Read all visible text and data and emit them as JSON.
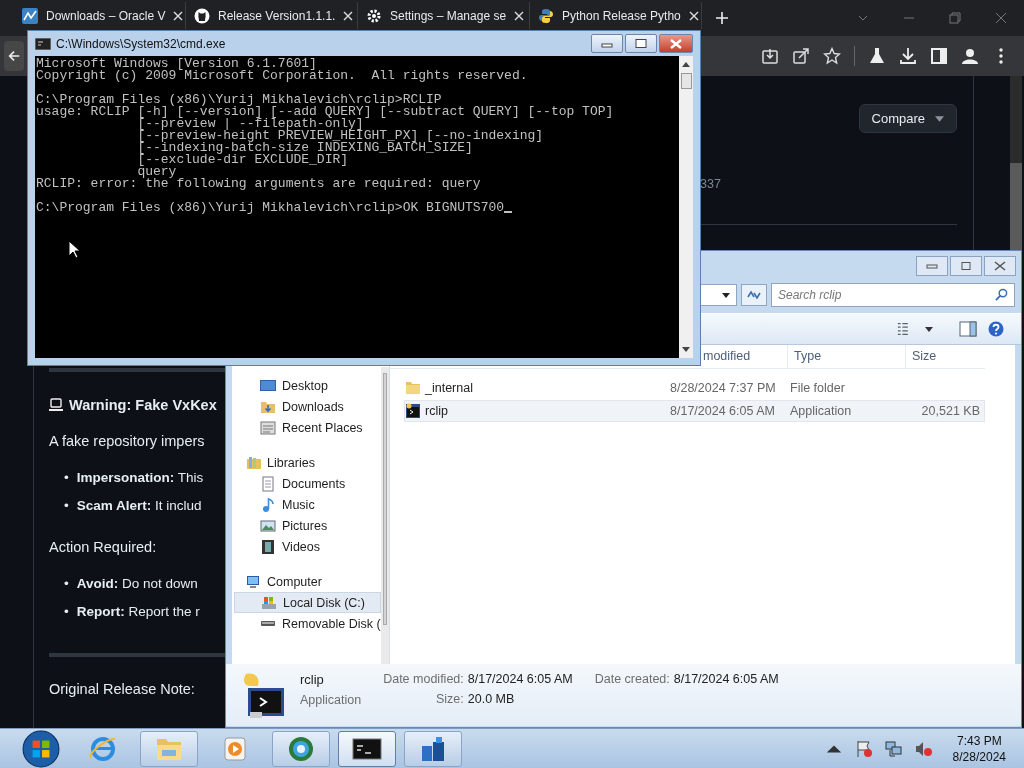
{
  "browser": {
    "tabs": [
      {
        "title": "Downloads – Oracle V",
        "kind": "chart",
        "selected": false
      },
      {
        "title": "Release Version1.1.1.",
        "kind": "cat",
        "selected": false
      },
      {
        "title": "Settings – Manage se",
        "kind": "gear",
        "selected": false
      },
      {
        "title": "Python Release Pytho",
        "kind": "snake",
        "selected": false
      }
    ],
    "compare_button": "Compare",
    "fragment": "337",
    "article": {
      "heading": "Warning: Fake VxKex",
      "intro": "A fake repository impers",
      "bullets": [
        {
          "marker": "•",
          "text": "**Impersonation:** This"
        },
        {
          "marker": "•",
          "text": "**Scam Alert:** It includ"
        }
      ],
      "subheading": "Action Required:",
      "bullets2": [
        {
          "marker": "•",
          "text": "**Avoid:** Do not down"
        },
        {
          "marker": "•",
          "text": "**Report:** Report the r"
        }
      ],
      "footer": "Original Release Note:"
    }
  },
  "console": {
    "title": "C:\\Windows\\System32\\cmd.exe",
    "blocks": [
      [
        "Microsoft Windows [Version 6.1.7601]",
        "Copyright (c) 2009 Microsoft Corporation.  All rights reserved."
      ],
      [
        "C:\\Program Files (x86)\\Yurij Mikhalevich\\rclip>RCLIP",
        "usage: RCLIP [-h] [--version] [--add QUERY] [--subtract QUERY] [--top TOP]",
        "             [--preview | --filepath-only]",
        "             [--preview-height PREVIEW_HEIGHT_PX] [--no-indexing]",
        "             [--indexing-batch-size INDEXING_BATCH_SIZE]",
        "             [--exclude-dir EXCLUDE_DIR]",
        "             query",
        "RCLIP: error: the following arguments are required: query"
      ],
      [
        "C:\\Program Files (x86)\\Yurij Mikhalevich\\rclip>OK BIGNUTS700"
      ]
    ]
  },
  "explorer": {
    "search": {
      "placeholder": "Search rclip"
    },
    "nav": [
      {
        "items": [
          {
            "label": "Desktop",
            "kind": "desktop",
            "selected": false
          },
          {
            "label": "Downloads",
            "kind": "downloads",
            "selected": false
          },
          {
            "label": "Recent Places",
            "kind": "recent",
            "selected": false
          }
        ]
      },
      {
        "label": "Libraries",
        "kind": "libraries",
        "items": [
          {
            "label": "Documents",
            "kind": "documents",
            "selected": false
          },
          {
            "label": "Music",
            "kind": "music",
            "selected": false
          },
          {
            "label": "Pictures",
            "kind": "pictures",
            "selected": false
          },
          {
            "label": "Videos",
            "kind": "videos",
            "selected": false
          }
        ]
      },
      {
        "label": "Computer",
        "kind": "computer",
        "items": [
          {
            "label": "Local Disk (C:)",
            "kind": "disk",
            "selected": true
          },
          {
            "label": "Removable Disk (",
            "kind": "removable",
            "selected": false
          }
        ]
      }
    ],
    "columns": [
      "modified",
      "Type",
      "Size"
    ],
    "files": [
      {
        "name": "_internal",
        "kind": "folder",
        "modified": "8/28/2024 7:37 PM",
        "type": "File folder",
        "selected": false
      },
      {
        "name": "rclip",
        "kind": "app",
        "modified": "8/17/2024 6:05 AM",
        "type": "Application",
        "size": "20,521 KB",
        "selected": true
      }
    ],
    "details": {
      "name": "rclip",
      "type": "Application",
      "modified_label": "Date modified:",
      "modified": "8/17/2024 6:05 AM",
      "size_label": "Size:",
      "size": "20.0 MB",
      "created_label": "Date created:",
      "created": "8/17/2024 6:05 AM"
    }
  },
  "taskbar": {
    "items": [
      {
        "kind": "ie",
        "open": false,
        "selected": false
      },
      {
        "kind": "explorer",
        "open": true,
        "selected": false
      },
      {
        "kind": "media",
        "open": false,
        "selected": false
      },
      {
        "kind": "globe",
        "open": true,
        "selected": false
      },
      {
        "kind": "cmd",
        "open": true,
        "selected": true
      },
      {
        "kind": "app",
        "open": true,
        "selected": false
      }
    ],
    "time": "7:43 PM",
    "date": "8/28/2024"
  }
}
